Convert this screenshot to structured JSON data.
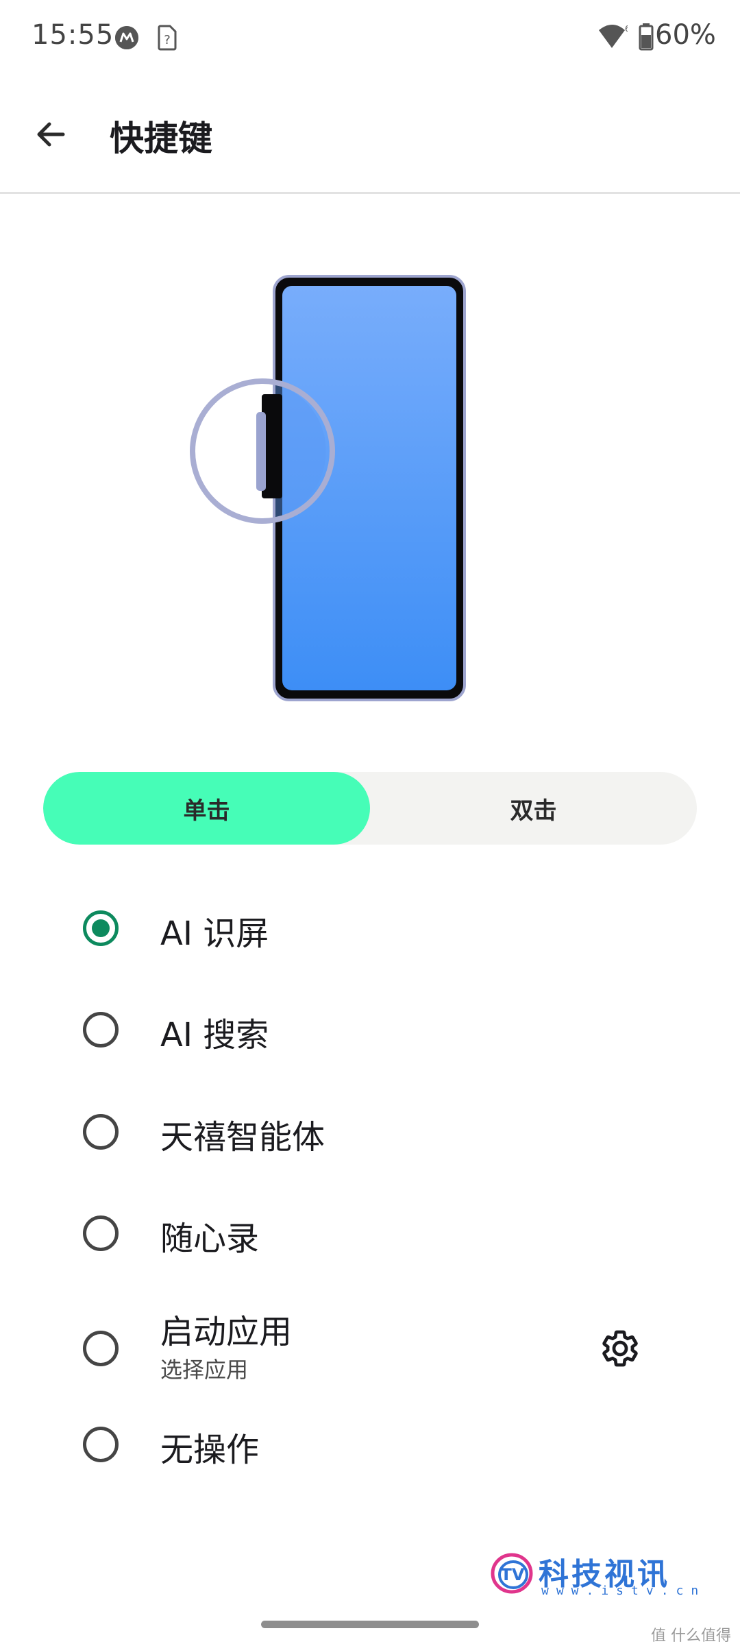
{
  "status_bar": {
    "time": "15:55",
    "battery_percent": "60%",
    "icons": [
      "motorola-icon",
      "sim-icon",
      "wifi-icon",
      "battery-icon"
    ]
  },
  "app_bar": {
    "title": "快捷键",
    "back_icon": "arrow-left-icon"
  },
  "illustration": {
    "screen_color_top": "#78adfb",
    "screen_color_bottom": "#3d8ef6",
    "highlight_color": "#a9aed3"
  },
  "tabs": {
    "selected": "单击",
    "items": [
      {
        "label": "单击",
        "selected": true
      },
      {
        "label": "双击",
        "selected": false
      }
    ],
    "accent": "#46fdb7"
  },
  "options": [
    {
      "label": "AI 识屏",
      "checked": true
    },
    {
      "label": "AI 搜索",
      "checked": false
    },
    {
      "label": "天禧智能体",
      "checked": false
    },
    {
      "label": "随心录",
      "checked": false
    },
    {
      "label": "启动应用",
      "sublabel": "选择应用",
      "checked": false,
      "has_settings": true
    },
    {
      "label": "无操作",
      "checked": false
    }
  ],
  "colors": {
    "radio_checked": "#0d8a5e",
    "radio_unchecked": "#454545"
  },
  "watermark": {
    "title": "科技视讯",
    "url": "www.istv.cn",
    "corner": "值 什么值得买"
  }
}
